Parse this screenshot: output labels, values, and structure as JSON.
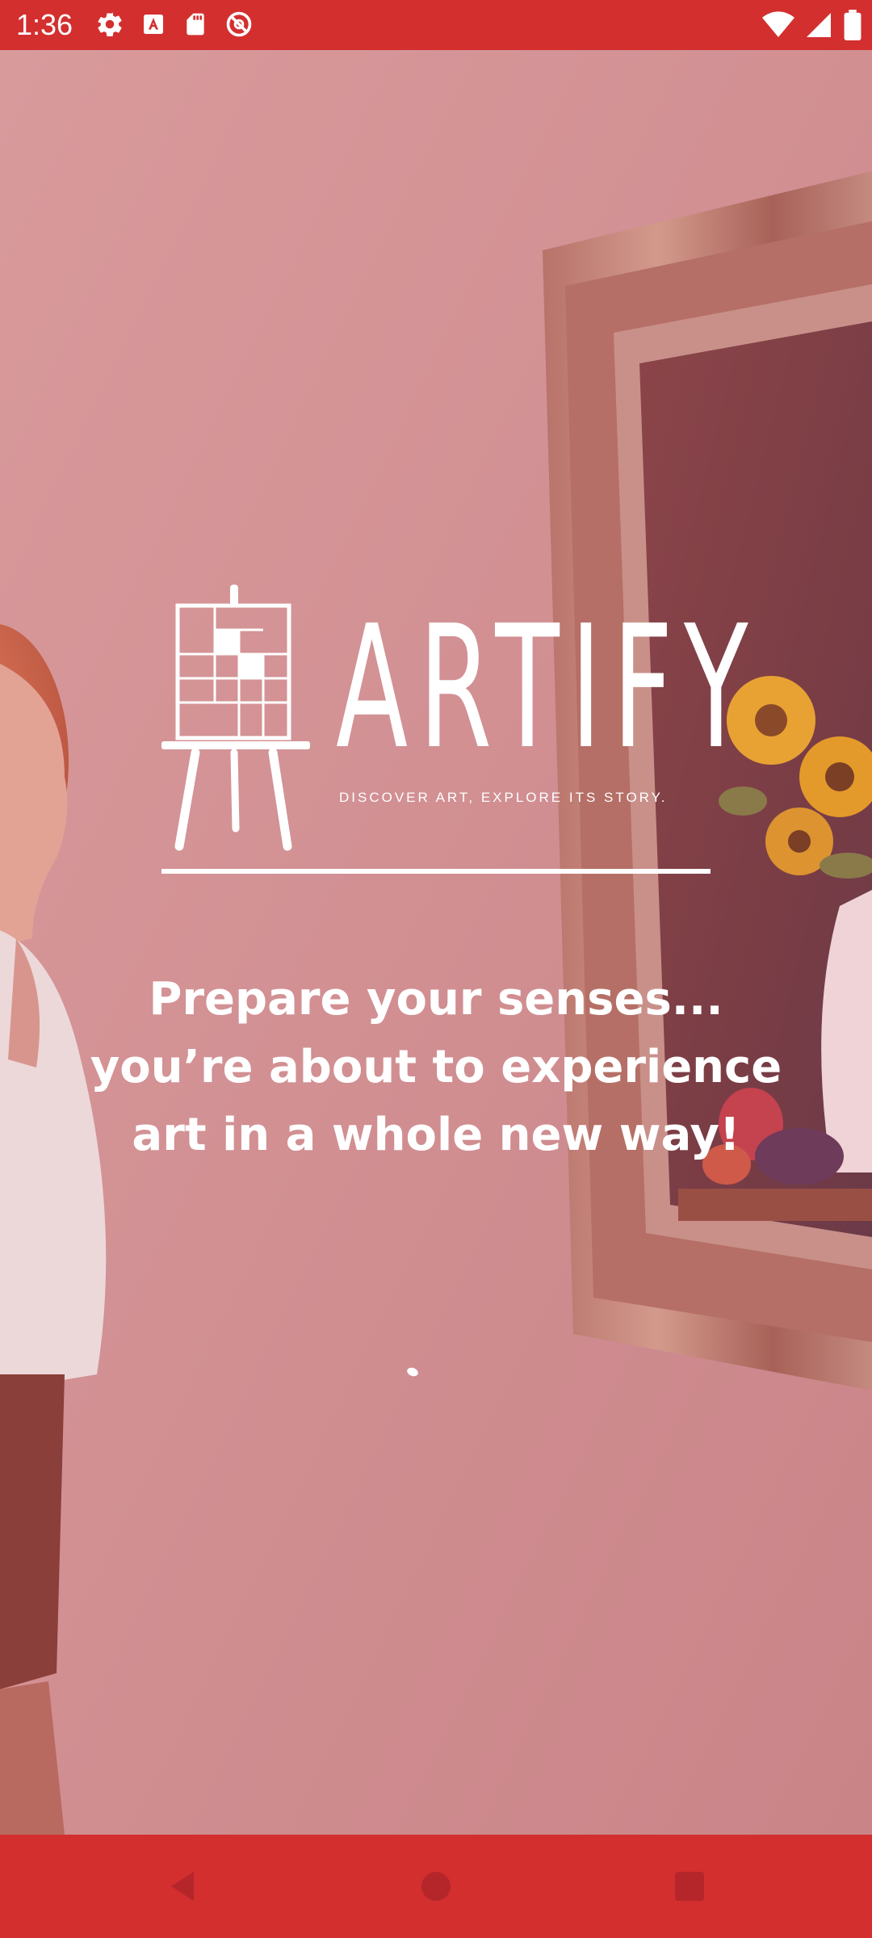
{
  "status_bar": {
    "time": "1:36",
    "left_icons": [
      "settings-icon",
      "text-a-icon",
      "sd-card-icon",
      "no-disturb-icon"
    ],
    "right_icons": [
      "wifi-icon",
      "signal-icon",
      "battery-icon"
    ],
    "color": "#d32f2f"
  },
  "logo": {
    "name": "ARTIFY",
    "tagline": "DISCOVER ART, EXPLORE ITS STORY."
  },
  "headline": {
    "line1": "Prepare your senses...",
    "line2": "you’re about to experience",
    "line3": "art in a whole new way!"
  },
  "nav_bar": {
    "back": "back-icon",
    "home": "home-icon",
    "recents": "recents-icon",
    "color": "#d32f2f"
  },
  "overlay_color": "#d48f93"
}
